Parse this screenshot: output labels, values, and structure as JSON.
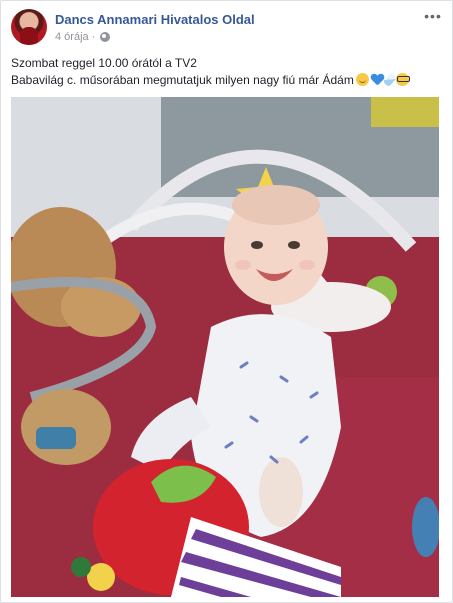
{
  "post": {
    "page_name": "Dancs Annamari Hivatalos Oldal",
    "time": "4 órája",
    "separator": "·",
    "privacy_icon": "globe-icon",
    "more_icon": "more-horizontal-icon",
    "text_line1": "Szombat reggel 10.00 órától a TV2",
    "text_line2": "Babavilág c. műsorában megmutatjuk milyen nagy fiú már Ádám",
    "emojis": [
      "smiling-face",
      "blue-heart",
      "baby-bottle",
      "nerd-face"
    ]
  },
  "colors": {
    "page_name": "#365899",
    "meta": "#90949c",
    "text": "#1d2129",
    "rug": "#8c2a3a"
  }
}
